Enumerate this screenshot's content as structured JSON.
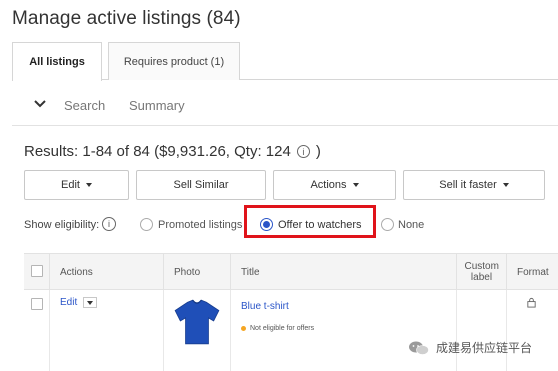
{
  "header": {
    "title": "Manage active listings (84)"
  },
  "tabs": [
    {
      "label": "All listings",
      "active": true
    },
    {
      "label": "Requires product (1)",
      "active": false
    }
  ],
  "toolbar": {
    "search_label": "Search",
    "summary_label": "Summary"
  },
  "results": {
    "text": "Results: 1-84 of 84 ($9,931.26, Qty: 124",
    "close": ")"
  },
  "actions": {
    "edit": "Edit",
    "sell_similar": "Sell Similar",
    "actions": "Actions",
    "sell_faster": "Sell it faster"
  },
  "eligibility": {
    "label": "Show eligibility:",
    "options": [
      {
        "label": "Promoted listings",
        "selected": false
      },
      {
        "label": "Offer to watchers",
        "selected": true
      },
      {
        "label": "None",
        "selected": false
      }
    ],
    "highlight_color": "#e0131a"
  },
  "table": {
    "columns": [
      "Actions",
      "Photo",
      "Title",
      "Custom label",
      "Format"
    ],
    "rows": [
      {
        "action": "Edit",
        "title": "Blue t-shirt",
        "status": "Not eligible for offers"
      }
    ]
  },
  "watermark": {
    "text": "成建易供应链平台"
  },
  "colors": {
    "link": "#2a55c8",
    "accent_dot": "#f5a623",
    "shirt": "#1f4fb8"
  }
}
